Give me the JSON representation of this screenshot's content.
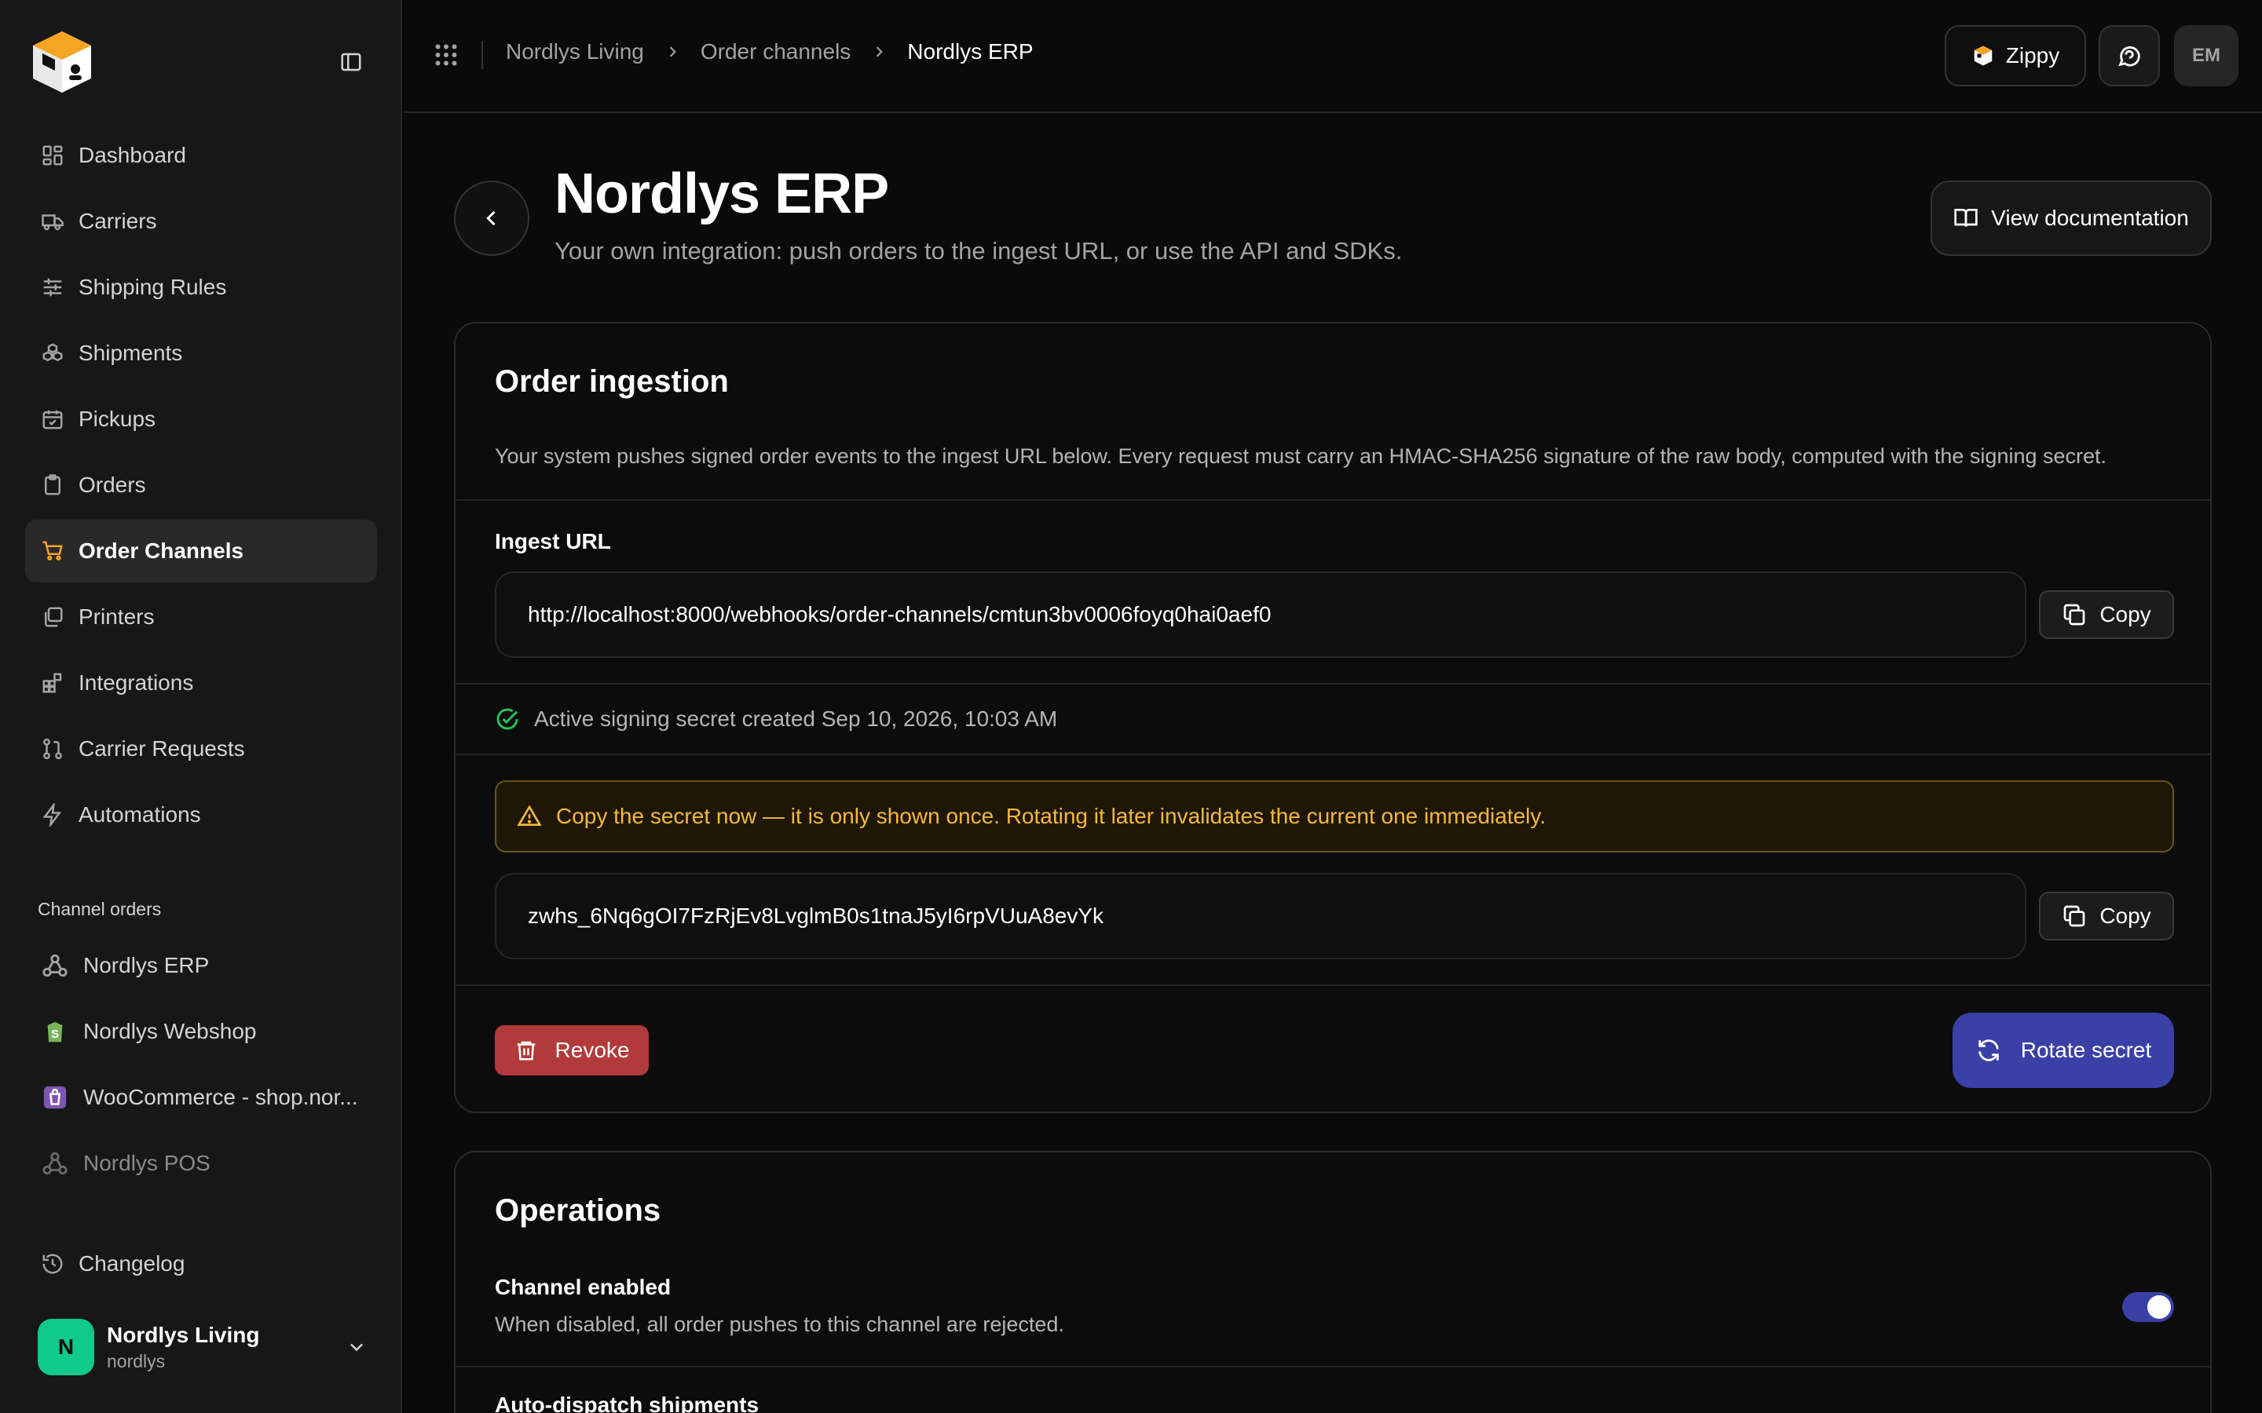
{
  "sidebar": {
    "nav": [
      {
        "label": "Dashboard",
        "icon": "dashboard-icon"
      },
      {
        "label": "Carriers",
        "icon": "truck-icon"
      },
      {
        "label": "Shipping Rules",
        "icon": "sliders-icon"
      },
      {
        "label": "Shipments",
        "icon": "boxes-icon"
      },
      {
        "label": "Pickups",
        "icon": "calendar-check-icon"
      },
      {
        "label": "Orders",
        "icon": "clipboard-icon"
      },
      {
        "label": "Order Channels",
        "icon": "cart-icon",
        "active": true
      },
      {
        "label": "Printers",
        "icon": "printer-icon"
      },
      {
        "label": "Integrations",
        "icon": "blocks-icon"
      },
      {
        "label": "Carrier Requests",
        "icon": "git-pull-request-icon"
      },
      {
        "label": "Automations",
        "icon": "zap-icon"
      }
    ],
    "channels_label": "Channel orders",
    "channels": [
      {
        "label": "Nordlys ERP",
        "icon": "webhook-icon"
      },
      {
        "label": "Nordlys Webshop",
        "icon": "shopify-icon"
      },
      {
        "label": "WooCommerce - shop.nor...",
        "icon": "woocommerce-icon"
      },
      {
        "label": "Nordlys POS",
        "icon": "webhook-icon",
        "dim": true
      }
    ],
    "changelog": "Changelog",
    "account": {
      "initial": "N",
      "name": "Nordlys Living",
      "slug": "nordlys"
    }
  },
  "topbar": {
    "breadcrumb": [
      "Nordlys Living",
      "Order channels",
      "Nordlys ERP"
    ],
    "zippy_label": "Zippy",
    "user_initials": "EM"
  },
  "header": {
    "title": "Nordlys ERP",
    "subtitle": "Your own integration: push orders to the ingest URL, or use the API and SDKs.",
    "doc_button": "View documentation"
  },
  "ingestion": {
    "title": "Order ingestion",
    "description": "Your system pushes signed order events to the ingest URL below. Every request must carry an HMAC-SHA256 signature of the raw body, computed with the signing secret.",
    "url_label": "Ingest URL",
    "url": "http://localhost:8000/webhooks/order-channels/cmtun3bv0006foyq0hai0aef0",
    "copy_label": "Copy",
    "status": "Active signing secret created Sep 10, 2026, 10:03 AM",
    "warning": "Copy the secret now — it is only shown once. Rotating it later invalidates the current one immediately.",
    "secret": "zwhs_6Nq6gOI7FzRjEv8LvglmB0s1tnaJ5yI6rpVUuA8evYk",
    "revoke_label": "Revoke",
    "rotate_label": "Rotate secret"
  },
  "operations": {
    "title": "Operations",
    "channel_enabled_label": "Channel enabled",
    "channel_enabled_desc": "When disabled, all order pushes to this channel are rejected.",
    "channel_enabled": true,
    "auto_dispatch_label": "Auto-dispatch shipments"
  },
  "colors": {
    "accent": "#3a40a6",
    "brand_orange": "#f5a524",
    "danger": "#b33a3a",
    "success": "#22c55e",
    "warning": "#f5b83d"
  }
}
